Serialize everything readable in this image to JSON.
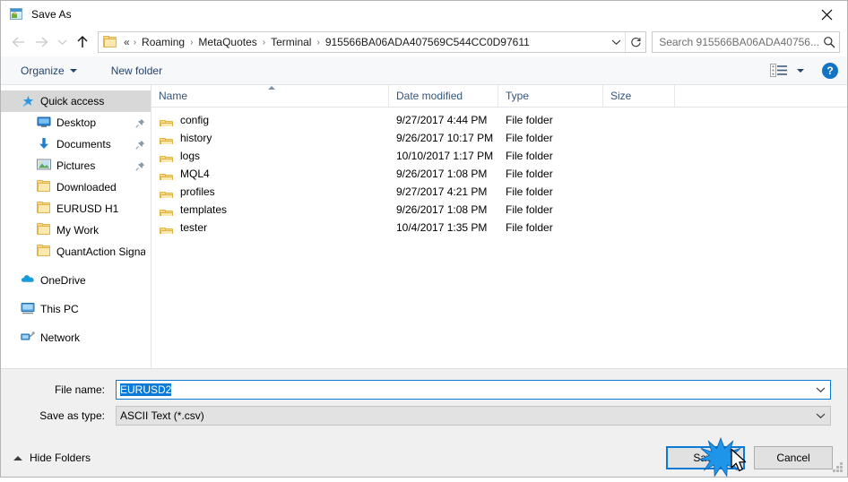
{
  "window": {
    "title": "Save As",
    "title_icon": "save-as-icon",
    "close_icon": "close-icon"
  },
  "nav": {
    "back_icon": "arrow-left-icon",
    "forward_icon": "arrow-right-icon",
    "recent_icon": "chevron-down-icon",
    "up_icon": "arrow-up-icon",
    "refresh_icon": "refresh-icon",
    "dropdown_icon": "chevron-down-icon",
    "folder_icon": "folder-icon",
    "overflow": "«",
    "separator": "›",
    "breadcrumbs": [
      "Roaming",
      "MetaQuotes",
      "Terminal",
      "915566BA06ADA407569C544CC0D97611"
    ]
  },
  "search": {
    "placeholder": "Search 915566BA06ADA40756...",
    "icon": "search-icon"
  },
  "toolbar": {
    "organize_label": "Organize",
    "new_folder_label": "New folder",
    "view_icon": "list-view-icon",
    "view_caret_icon": "chevron-down-icon",
    "help_label": "?",
    "help_icon": "help-icon"
  },
  "sidebar": {
    "items": [
      {
        "label": "Quick access",
        "icon": "star-pin-icon",
        "level": 0,
        "selected": true,
        "pinned": false
      },
      {
        "label": "Desktop",
        "icon": "monitor-icon",
        "level": 1,
        "selected": false,
        "pinned": true
      },
      {
        "label": "Documents",
        "icon": "download-arrow-icon",
        "level": 1,
        "selected": false,
        "pinned": true
      },
      {
        "label": "Pictures",
        "icon": "picture-icon",
        "level": 1,
        "selected": false,
        "pinned": true
      },
      {
        "label": "Downloaded",
        "icon": "folder-icon",
        "level": 1,
        "selected": false,
        "pinned": false
      },
      {
        "label": "EURUSD H1",
        "icon": "folder-icon",
        "level": 1,
        "selected": false,
        "pinned": false
      },
      {
        "label": "My Work",
        "icon": "folder-icon",
        "level": 1,
        "selected": false,
        "pinned": false
      },
      {
        "label": "QuantAction Signal",
        "icon": "folder-icon",
        "level": 1,
        "selected": false,
        "pinned": false
      },
      {
        "label": "OneDrive",
        "icon": "cloud-icon",
        "level": 0,
        "selected": false,
        "pinned": false,
        "gap_before": true
      },
      {
        "label": "This PC",
        "icon": "pc-icon",
        "level": 0,
        "selected": false,
        "pinned": false,
        "gap_before": true
      },
      {
        "label": "Network",
        "icon": "network-icon",
        "level": 0,
        "selected": false,
        "pinned": false,
        "gap_before": true
      }
    ]
  },
  "filelist": {
    "columns": [
      "Name",
      "Date modified",
      "Type",
      "Size"
    ],
    "sort_column": "Name",
    "sort_direction": "ascending",
    "rows": [
      {
        "name": "config",
        "date": "9/27/2017 4:44 PM",
        "type": "File folder",
        "size": "",
        "icon": "folder-icon"
      },
      {
        "name": "history",
        "date": "9/26/2017 10:17 PM",
        "type": "File folder",
        "size": "",
        "icon": "folder-icon"
      },
      {
        "name": "logs",
        "date": "10/10/2017 1:17 PM",
        "type": "File folder",
        "size": "",
        "icon": "folder-icon"
      },
      {
        "name": "MQL4",
        "date": "9/26/2017 1:08 PM",
        "type": "File folder",
        "size": "",
        "icon": "folder-icon"
      },
      {
        "name": "profiles",
        "date": "9/27/2017 4:21 PM",
        "type": "File folder",
        "size": "",
        "icon": "folder-icon"
      },
      {
        "name": "templates",
        "date": "9/26/2017 1:08 PM",
        "type": "File folder",
        "size": "",
        "icon": "folder-icon"
      },
      {
        "name": "tester",
        "date": "10/4/2017 1:35 PM",
        "type": "File folder",
        "size": "",
        "icon": "folder-icon"
      }
    ]
  },
  "form": {
    "filename_label": "File name:",
    "filename_value": "EURUSD2",
    "filetype_label": "Save as type:",
    "filetype_value": "ASCII Text (*.csv)",
    "dropdown_icon": "chevron-down-icon"
  },
  "footer": {
    "hide_folders_label": "Hide Folders",
    "hide_folders_icon": "chevron-up-icon",
    "save_label": "Save",
    "cancel_label": "Cancel",
    "resize_grip_icon": "resize-grip-icon"
  },
  "pointer": {
    "cursor_icon": "mouse-cursor-icon",
    "click_icon": "click-burst-icon"
  },
  "colors": {
    "accent": "#0a7ad4",
    "folder": "#fcd77f",
    "selection": "#d8d8d8",
    "header_text": "#33557a",
    "toolbar_bg": "#f7f8fa",
    "form_bg": "#f0f0f0"
  }
}
